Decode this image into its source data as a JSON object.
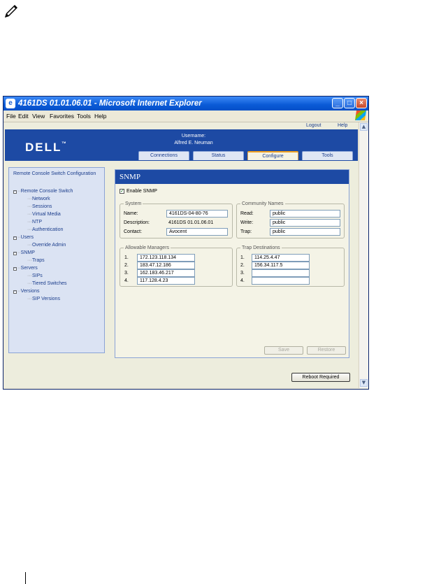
{
  "browser": {
    "title": "4161DS 01.01.06.01 - Microsoft Internet Explorer",
    "menu": [
      "File",
      "Edit",
      "View",
      "Favorites",
      "Tools",
      "Help"
    ]
  },
  "topbar": {
    "logout": "Logout",
    "help": "Help"
  },
  "header": {
    "logo": "DELL",
    "logo_tm": "TM",
    "username_label": "Username:",
    "username": "Alfred E. Neuman"
  },
  "tabs": [
    {
      "label": "Connections",
      "active": false
    },
    {
      "label": "Status",
      "active": false
    },
    {
      "label": "Configure",
      "active": true
    },
    {
      "label": "Tools",
      "active": false
    }
  ],
  "sidebar": {
    "title": "Remote Console Switch Configuration",
    "tree": [
      {
        "label": "Remote Console Switch",
        "children": [
          "Network",
          "Sessions",
          "Virtual Media",
          "NTP",
          "Authentication"
        ]
      },
      {
        "label": "Users",
        "children": [
          "Override Admin"
        ]
      },
      {
        "label": "SNMP",
        "children": [
          "Traps"
        ]
      },
      {
        "label": "Servers",
        "children": [
          "SIPs",
          "Tiered Switches"
        ]
      },
      {
        "label": "Versions",
        "children": [
          "SIP Versions"
        ]
      }
    ]
  },
  "panel": {
    "title": "SNMP",
    "enable_label": "Enable SNMP",
    "enable_checked": true,
    "system": {
      "legend": "System",
      "name_label": "Name:",
      "name": "4161DS-04-80-76",
      "description_label": "Description:",
      "description": "4161DS 01.01.06.01",
      "contact_label": "Contact:",
      "contact": "Avocent"
    },
    "community": {
      "legend": "Community Names",
      "read_label": "Read:",
      "read": "public",
      "write_label": "Write:",
      "write": "public",
      "trap_label": "Trap:",
      "trap": "public"
    },
    "managers": {
      "legend": "Allowable Managers",
      "items": [
        {
          "num": "1.",
          "value": "172.123.118.134"
        },
        {
          "num": "2.",
          "value": "183.47.12.186"
        },
        {
          "num": "3.",
          "value": "162.183.46.217"
        },
        {
          "num": "4.",
          "value": "117.128.4.23"
        }
      ]
    },
    "traps": {
      "legend": "Trap Destinations",
      "items": [
        {
          "num": "1.",
          "value": "114.25.4.47"
        },
        {
          "num": "2.",
          "value": "156.34.117.5"
        },
        {
          "num": "3.",
          "value": ""
        },
        {
          "num": "4.",
          "value": ""
        }
      ]
    },
    "save_label": "Save",
    "restore_label": "Restore"
  },
  "reboot_label": "Reboot Required"
}
